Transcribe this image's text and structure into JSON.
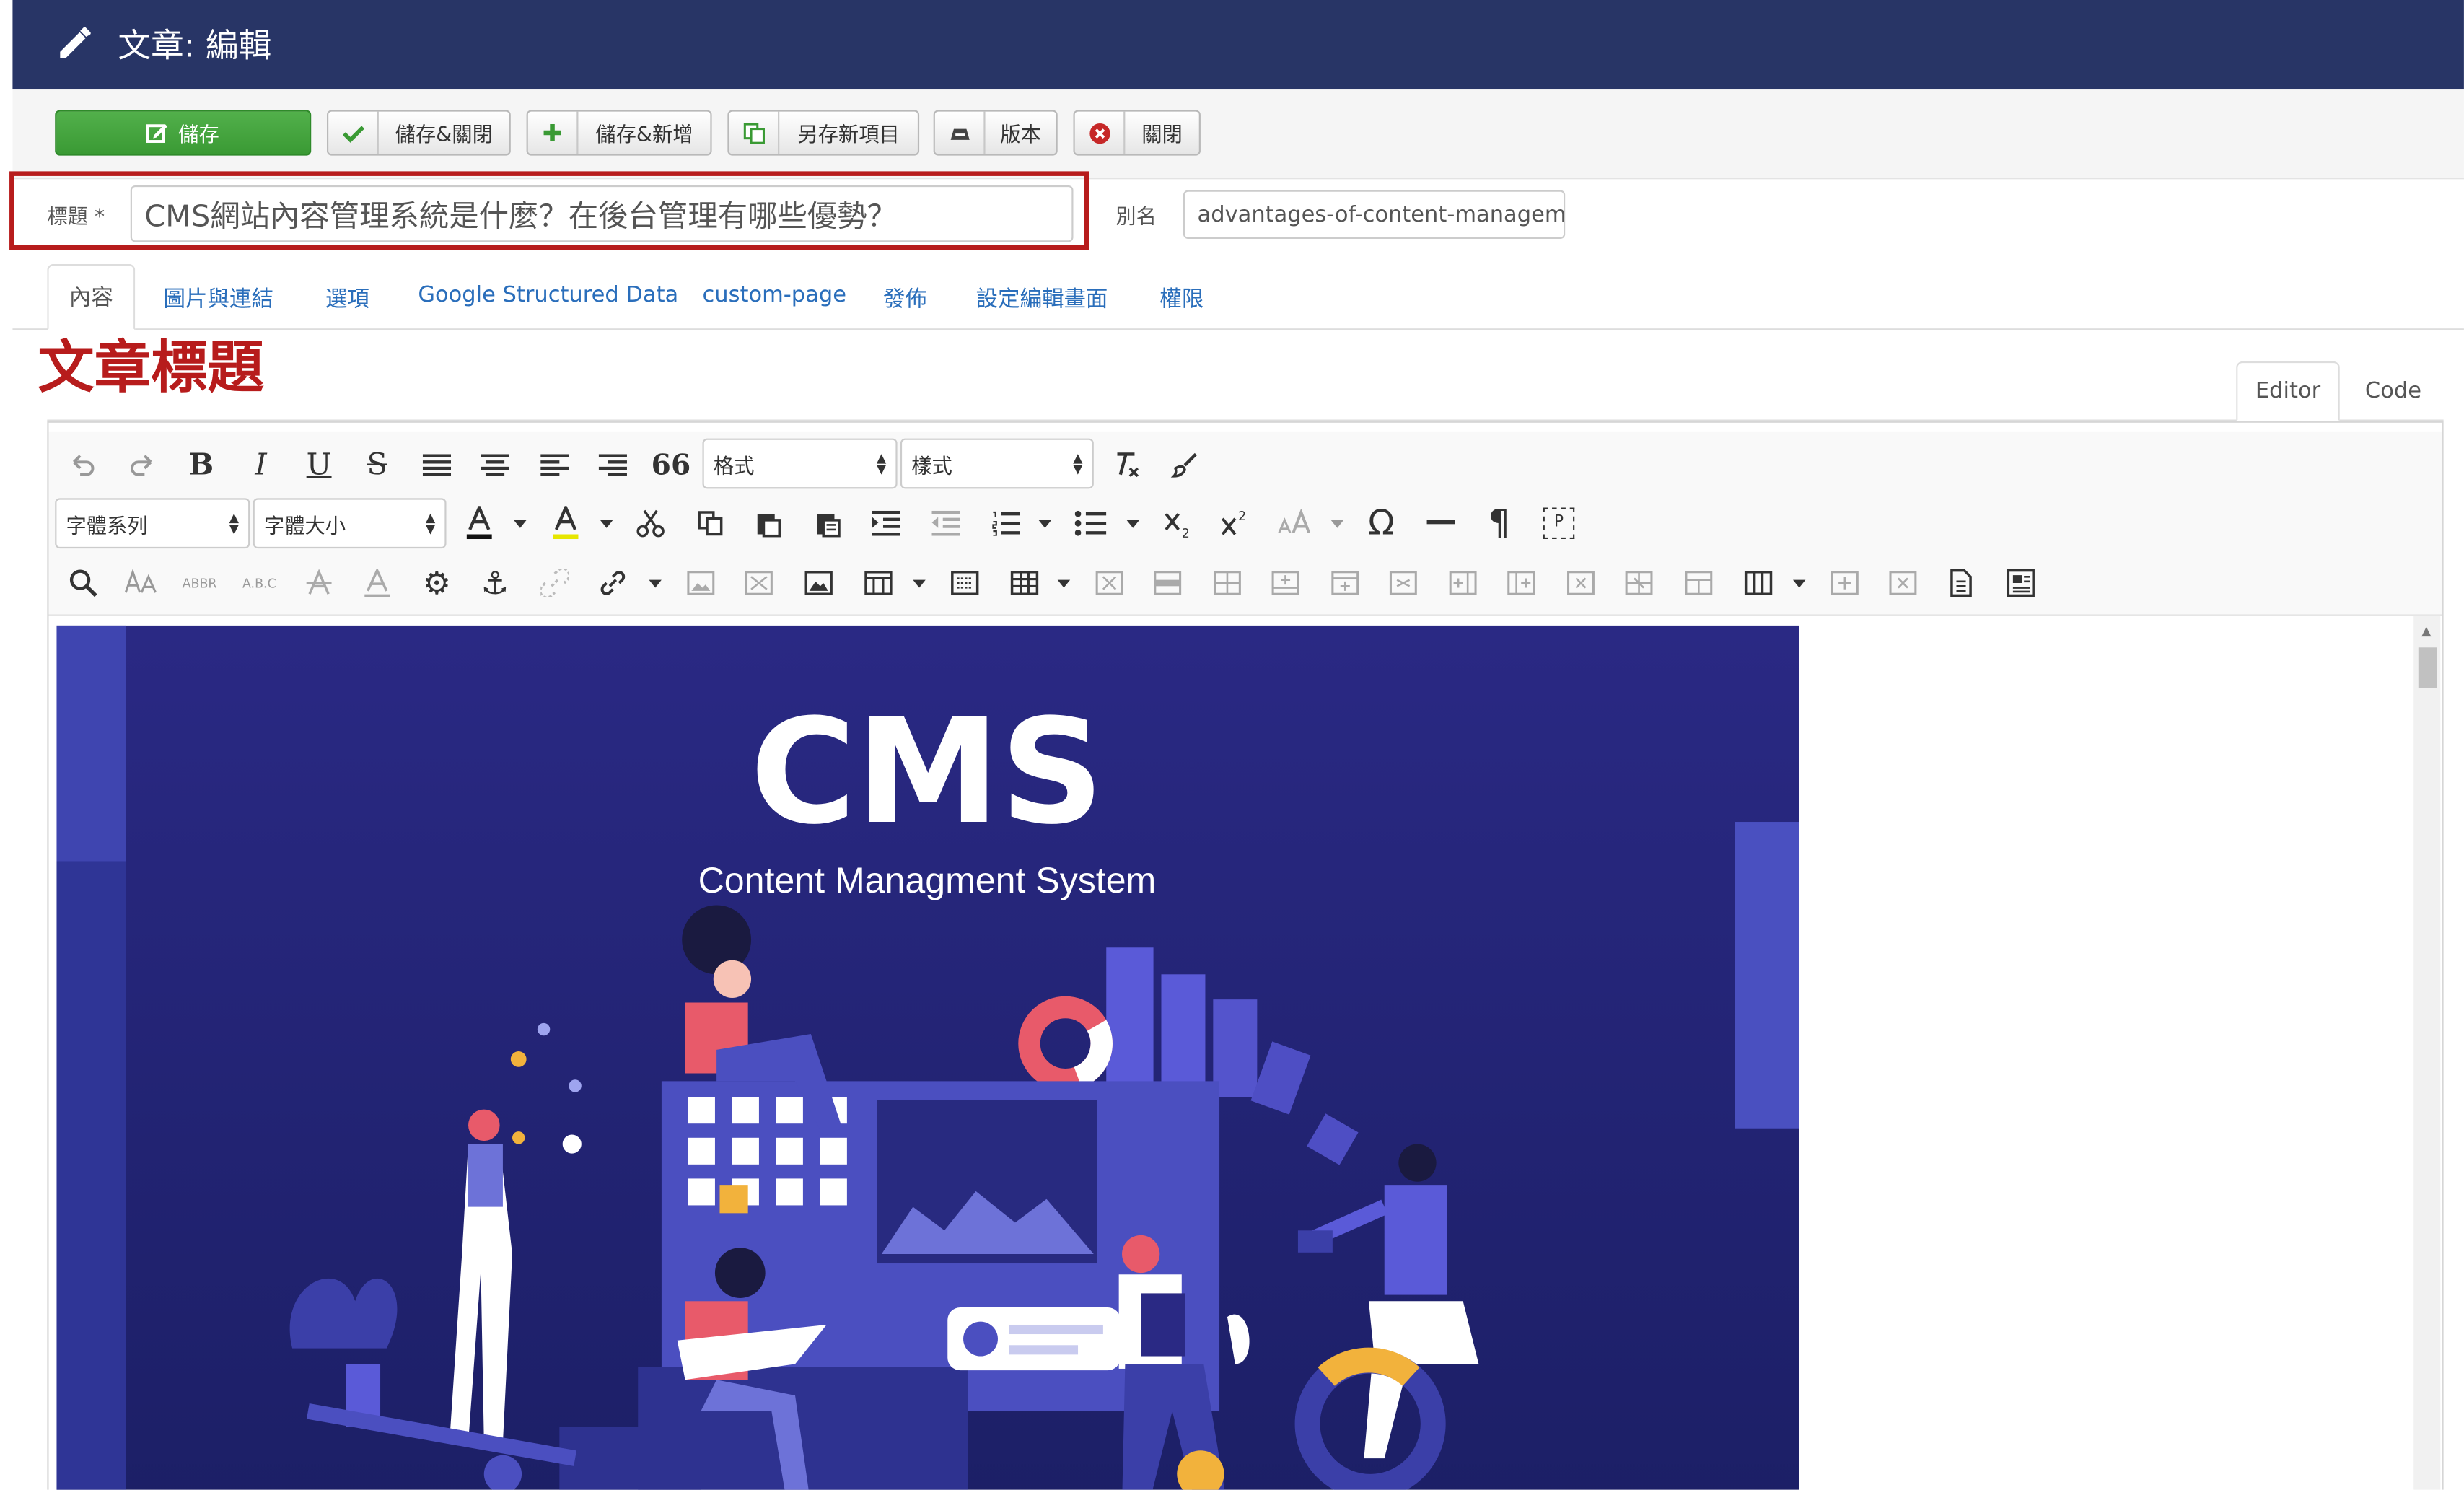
{
  "header": {
    "title": "文章: 編輯"
  },
  "toolbar": {
    "save": "儲存",
    "save_close": "儲存&關閉",
    "save_new": "儲存&新增",
    "save_copy": "另存新項目",
    "versions": "版本",
    "close": "關閉"
  },
  "form": {
    "title_label": "標題 *",
    "title_value": "CMS網站內容管理系統是什麼？在後台管理有哪些優勢？",
    "alias_label": "別名",
    "alias_value": "advantages-of-content-managemen"
  },
  "tabs": [
    "內容",
    "圖片與連結",
    "選項",
    "Google Structured Data",
    "custom-page",
    "發佈",
    "設定編輯畫面",
    "權限"
  ],
  "annotation": "文章標題",
  "editor_tabs": {
    "editor": "Editor",
    "code": "Code"
  },
  "editor_selects": {
    "format": "格式",
    "styles": "樣式",
    "font_family": "字體系列",
    "font_size": "字體大小"
  },
  "editor_glyphs": {
    "bold": "B",
    "italic": "I",
    "underline": "U",
    "strike": "S",
    "quote": "66",
    "omega": "Ω",
    "pilcrow": "¶",
    "abbr": "ABBR",
    "abc": "A.B.C",
    "page_break": "P"
  },
  "image": {
    "heading": "CMS",
    "subheading": "Content Managment System"
  },
  "colors": {
    "header_bg": "#283566",
    "accent_red": "#b71c1c",
    "link_blue": "#2a6ebb",
    "save_green": "#3a9a34",
    "image_bg": "#29287a"
  }
}
